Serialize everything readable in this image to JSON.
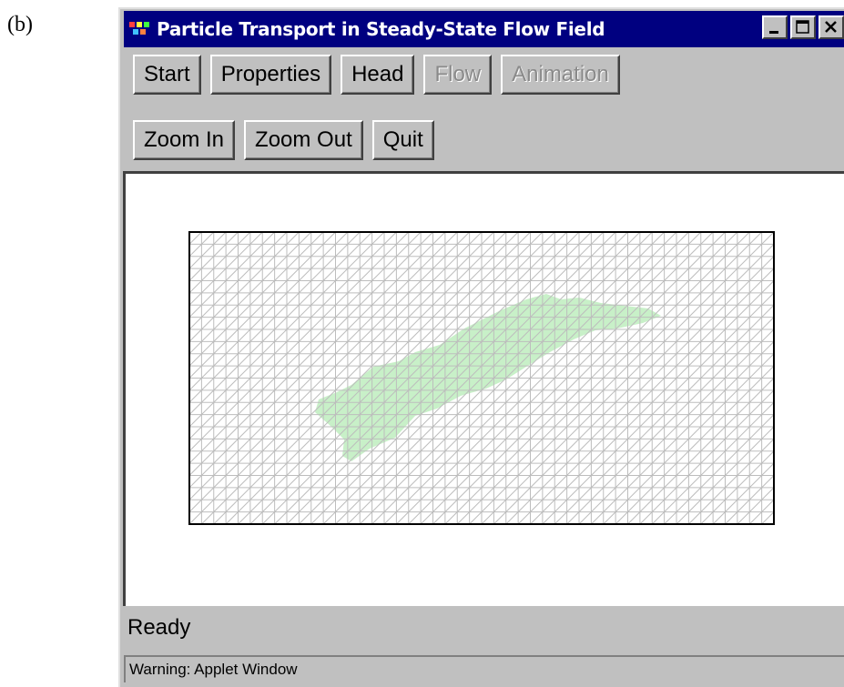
{
  "figure_label": "(b)",
  "window": {
    "title": "Particle Transport in Steady-State Flow Field",
    "controls": [
      "minimize",
      "maximize",
      "close"
    ]
  },
  "toolbar": {
    "row1": [
      {
        "label": "Start",
        "enabled": true
      },
      {
        "label": "Properties",
        "enabled": true
      },
      {
        "label": "Head",
        "enabled": true
      },
      {
        "label": "Flow",
        "enabled": false
      },
      {
        "label": "Animation",
        "enabled": false
      }
    ],
    "row2": [
      {
        "label": "Zoom In",
        "enabled": true
      },
      {
        "label": "Zoom Out",
        "enabled": true
      },
      {
        "label": "Quit",
        "enabled": true
      }
    ]
  },
  "grid": {
    "columns": 48,
    "rows": 24,
    "line_color": "#bdbdbd",
    "plume_color": "#c8f0c8"
  },
  "status": "Ready",
  "applet_warning": "Warning: Applet Window",
  "colors": {
    "titlebar": "#000080",
    "face": "#c0c0c0",
    "disabled_text": "#8a8a8a"
  }
}
